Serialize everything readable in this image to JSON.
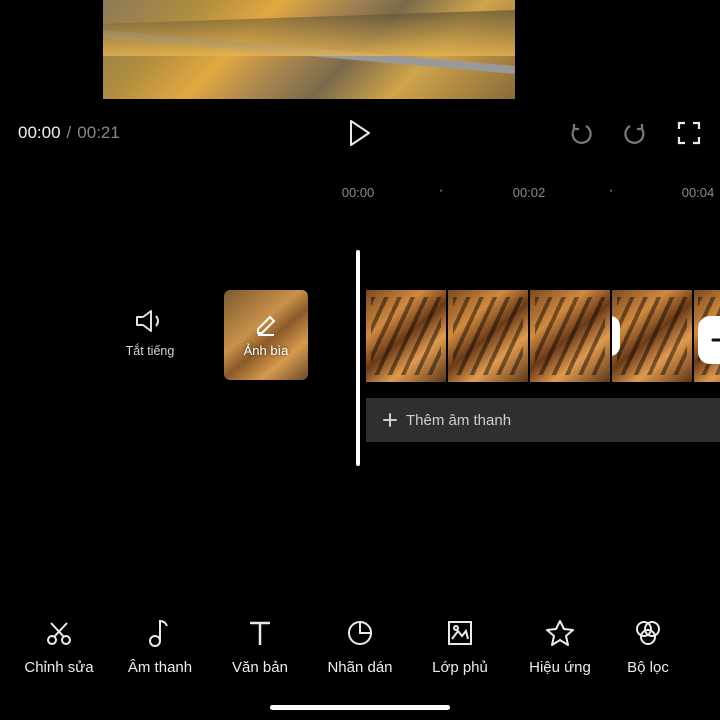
{
  "playback": {
    "current": "00:00",
    "separator": "/",
    "duration": "00:21"
  },
  "ruler": {
    "t1": "00:00",
    "t2": "00:02",
    "t3": "00:04"
  },
  "timeline": {
    "mute_label": "Tắt tiếng",
    "cover_label": "Ảnh bìa",
    "add_audio_label": "Thêm âm thanh"
  },
  "toolbar": [
    {
      "label": "Chỉnh sửa"
    },
    {
      "label": "Âm thanh"
    },
    {
      "label": "Văn bản"
    },
    {
      "label": "Nhãn dán"
    },
    {
      "label": "Lớp phủ"
    },
    {
      "label": "Hiệu ứng"
    },
    {
      "label": "Bộ lọc"
    }
  ]
}
